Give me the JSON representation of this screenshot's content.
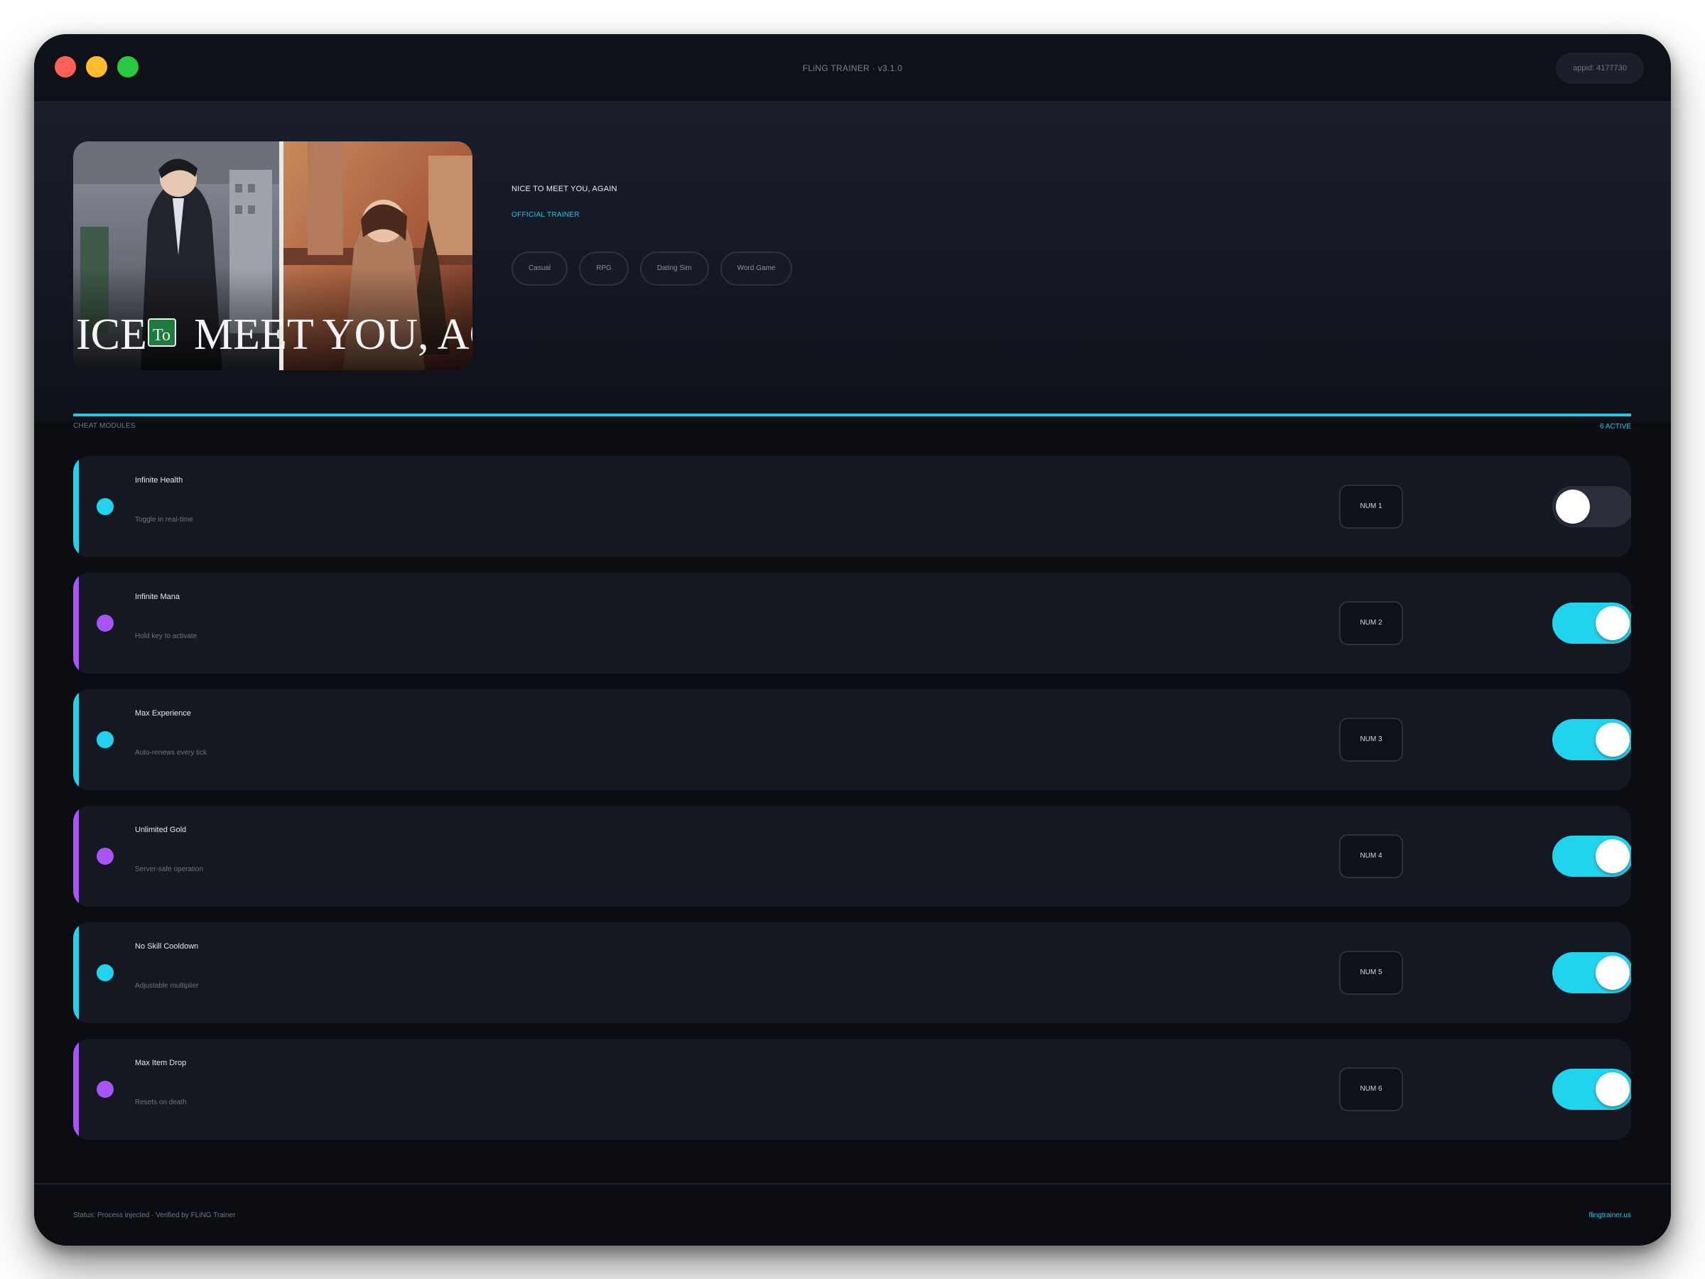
{
  "window": {
    "title": "FLiNG TRAINER · v3.1.0",
    "appid": "appid: 4177730"
  },
  "game": {
    "title": "NICE TO MEET YOU, AGAIN",
    "badge": "OFFICIAL TRAINER",
    "tags": [
      "Casual",
      "RPG",
      "Dating Sim",
      "Word Game"
    ],
    "cover_text_left": "ICE",
    "cover_logo": "To",
    "cover_text_right": "MEET YOU, AGAI"
  },
  "section": {
    "label": "CHEAT MODULES",
    "active_count": "6 ACTIVE"
  },
  "modules": [
    {
      "name": "Infinite Health",
      "desc": "Toggle in real-time",
      "key": "NUM 1",
      "enabled": false,
      "color": "#22d3ee"
    },
    {
      "name": "Infinite Mana",
      "desc": "Hold key to activate",
      "key": "NUM 2",
      "enabled": true,
      "color": "#a855f7"
    },
    {
      "name": "Max Experience",
      "desc": "Auto-renews every tick",
      "key": "NUM 3",
      "enabled": true,
      "color": "#22d3ee"
    },
    {
      "name": "Unlimited Gold",
      "desc": "Server-safe operation",
      "key": "NUM 4",
      "enabled": true,
      "color": "#a855f7"
    },
    {
      "name": "No Skill Cooldown",
      "desc": "Adjustable multiplier",
      "key": "NUM 5",
      "enabled": true,
      "color": "#22d3ee"
    },
    {
      "name": "Max Item Drop",
      "desc": "Resets on death",
      "key": "NUM 6",
      "enabled": true,
      "color": "#a855f7"
    }
  ],
  "footer": {
    "status": "Status: Process injected · Verified by FLiNG Trainer",
    "link": "flingtrainer.us"
  },
  "colors": {
    "accent": "#22d3ee",
    "purple": "#a855f7",
    "background": "#0b0d12"
  }
}
